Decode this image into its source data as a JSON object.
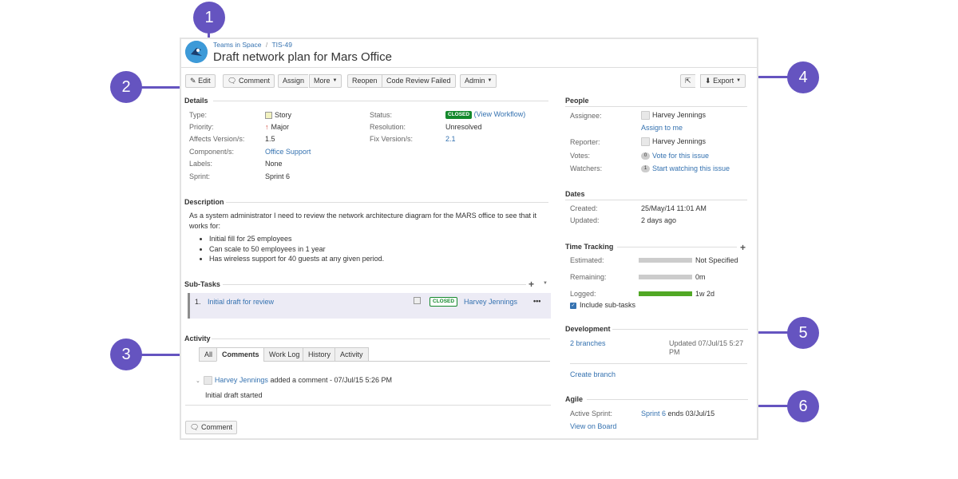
{
  "colors": {
    "callout": "#6554c0",
    "link": "#3572b0",
    "closed": "#14892c",
    "logged": "#51a825"
  },
  "breadcrumb": {
    "project": "Teams in Space",
    "separator": "/",
    "key": "TIS-49"
  },
  "issue": {
    "title": "Draft network plan for Mars Office"
  },
  "toolbar": {
    "edit": "Edit",
    "comment": "Comment",
    "assign": "Assign",
    "more": "More",
    "reopen": "Reopen",
    "code_review_failed": "Code Review Failed",
    "admin": "Admin",
    "export": "Export"
  },
  "details": {
    "heading": "Details",
    "type_label": "Type:",
    "type_value": "Story",
    "priority_label": "Priority:",
    "priority_value": "Major",
    "affects_label": "Affects Version/s:",
    "affects_value": "1.5",
    "component_label": "Component/s:",
    "component_value": "Office Support",
    "labels_label": "Labels:",
    "labels_value": "None",
    "sprint_label": "Sprint:",
    "sprint_value": "Sprint 6",
    "status_label": "Status:",
    "status_value": "CLOSED",
    "view_workflow": "(View Workflow)",
    "resolution_label": "Resolution:",
    "resolution_value": "Unresolved",
    "fix_label": "Fix Version/s:",
    "fix_value": "2.1"
  },
  "description": {
    "heading": "Description",
    "text": "As a system administrator I need to review the network architecture diagram for the MARS office to see that it works for:",
    "bullets": [
      "Initial fill for 25 employees",
      "Can scale to 50 employees in 1 year",
      "Has wireless support for 40 guests at any given period."
    ]
  },
  "subtasks": {
    "heading": "Sub-Tasks",
    "items": [
      {
        "num": "1.",
        "title": "Initial draft for review",
        "status": "CLOSED",
        "assignee": "Harvey Jennings",
        "menu": "•••"
      }
    ]
  },
  "activity": {
    "heading": "Activity",
    "tabs": [
      "All",
      "Comments",
      "Work Log",
      "History",
      "Activity"
    ],
    "comment_author": "Harvey Jennings",
    "comment_meta": "added a comment - 07/Jul/15 5:26 PM",
    "comment_text": "Initial draft started",
    "comment_button": "Comment"
  },
  "people": {
    "heading": "People",
    "assignee_label": "Assignee:",
    "assignee_value": "Harvey Jennings",
    "assign_to_me": "Assign to me",
    "reporter_label": "Reporter:",
    "reporter_value": "Harvey Jennings",
    "votes_label": "Votes:",
    "votes_count": "0",
    "vote_link": "Vote for this issue",
    "watchers_label": "Watchers:",
    "watchers_count": "1",
    "watch_link": "Start watching this issue"
  },
  "dates": {
    "heading": "Dates",
    "created_label": "Created:",
    "created_value": "25/May/14 11:01 AM",
    "updated_label": "Updated:",
    "updated_value": "2 days ago"
  },
  "time_tracking": {
    "heading": "Time Tracking",
    "estimated_label": "Estimated:",
    "estimated_value": "Not Specified",
    "estimated_fraction": 0,
    "remaining_label": "Remaining:",
    "remaining_value": "0m",
    "remaining_fraction": 0,
    "logged_label": "Logged:",
    "logged_value": "1w 2d",
    "logged_fraction": 1,
    "include_subtasks": "Include sub-tasks"
  },
  "development": {
    "heading": "Development",
    "branches": "2 branches",
    "updated_line1": "Updated 07/Jul/15 5:27",
    "updated_line2": "PM",
    "create_branch": "Create branch"
  },
  "agile": {
    "heading": "Agile",
    "active_sprint_label": "Active Sprint:",
    "sprint_link": "Sprint 6",
    "sprint_ends": "ends 03/Jul/15",
    "view_on_board": "View on Board"
  },
  "callouts": [
    "1",
    "2",
    "3",
    "4",
    "5",
    "6"
  ]
}
